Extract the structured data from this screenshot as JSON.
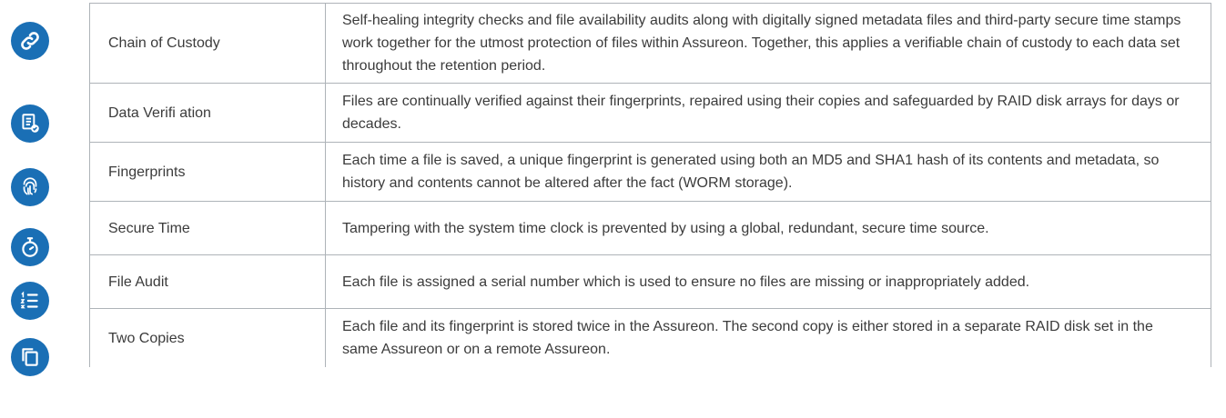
{
  "colors": {
    "icon_bg": "#1a6fb5",
    "border": "#aeb3b8",
    "text": "#3b3b3b"
  },
  "rows": [
    {
      "icon": "link-icon",
      "name": "Chain of Custody",
      "desc": "Self-healing integrity checks and file availability audits along with digitally signed metadata files and third-party secure time stamps work together for the utmost protection of files within Assureon. Together, this applies a verifiable chain of custody to each data set throughout the retention period."
    },
    {
      "icon": "document-check-icon",
      "name": "Data Verifi  ation",
      "desc": "Files are continually verified against their fingerprints, repaired using their copies and safeguarded by RAID disk arrays for days or decades."
    },
    {
      "icon": "fingerprint-icon",
      "name": "Fingerprints",
      "desc": "Each time a file is saved, a unique fingerprint is generated using both an MD5 and SHA1 hash of its contents and metadata, so history and contents cannot be altered after the fact (WORM storage)."
    },
    {
      "icon": "stopwatch-icon",
      "name": "Secure Time",
      "desc": "Tampering with the system time clock is prevented by using a global, redundant, secure time source."
    },
    {
      "icon": "numbered-list-icon",
      "name": "File Audit",
      "desc": "Each file is assigned a serial number which is used to ensure no files are missing or inappropriately added."
    },
    {
      "icon": "copy-icon",
      "name": "Two Copies",
      "desc": "Each file and its fingerprint is stored twice in the Assureon. The second copy is either stored in a separate RAID disk set in the same Assureon or on a remote Assureon."
    }
  ]
}
